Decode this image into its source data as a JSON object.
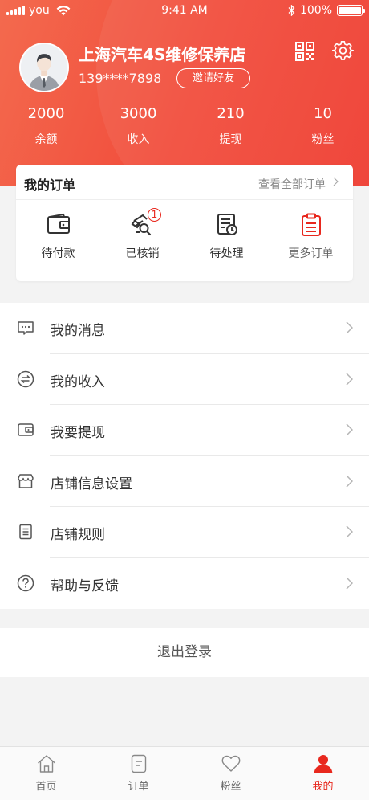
{
  "status_bar": {
    "carrier": "you",
    "time": "9:41 AM",
    "battery": "100%"
  },
  "profile": {
    "shop_name": "上海汽车4S维修保养店",
    "phone": "139****7898",
    "invite_label": "邀请好友"
  },
  "stats": [
    {
      "value": "2000",
      "label": "余额"
    },
    {
      "value": "3000",
      "label": "收入"
    },
    {
      "value": "210",
      "label": "提现"
    },
    {
      "value": "10",
      "label": "粉丝"
    }
  ],
  "orders": {
    "title": "我的订单",
    "view_all": "查看全部订单",
    "items": [
      {
        "label": "待付款",
        "icon": "wallet-icon"
      },
      {
        "label": "已核销",
        "icon": "verified-ticket-icon",
        "badge": "1"
      },
      {
        "label": "待处理",
        "icon": "pending-list-icon"
      },
      {
        "label": "更多订单",
        "icon": "more-orders-icon"
      }
    ]
  },
  "menu": [
    {
      "label": "我的消息",
      "icon": "message-icon"
    },
    {
      "label": "我的收入",
      "icon": "exchange-icon"
    },
    {
      "label": "我要提现",
      "icon": "wallet-icon"
    },
    {
      "label": "店铺信息设置",
      "icon": "shop-icon"
    },
    {
      "label": "店铺规则",
      "icon": "rules-icon"
    },
    {
      "label": "帮助与反馈",
      "icon": "help-icon"
    }
  ],
  "logout_label": "退出登录",
  "tabs": [
    {
      "label": "首页",
      "icon": "home-icon"
    },
    {
      "label": "订单",
      "icon": "order-icon"
    },
    {
      "label": "粉丝",
      "icon": "heart-icon"
    },
    {
      "label": "我的",
      "icon": "user-icon",
      "active": true
    }
  ],
  "colors": {
    "accent": "#e8281e",
    "header_start": "#f36a4e",
    "header_end": "#ef3b2f"
  }
}
